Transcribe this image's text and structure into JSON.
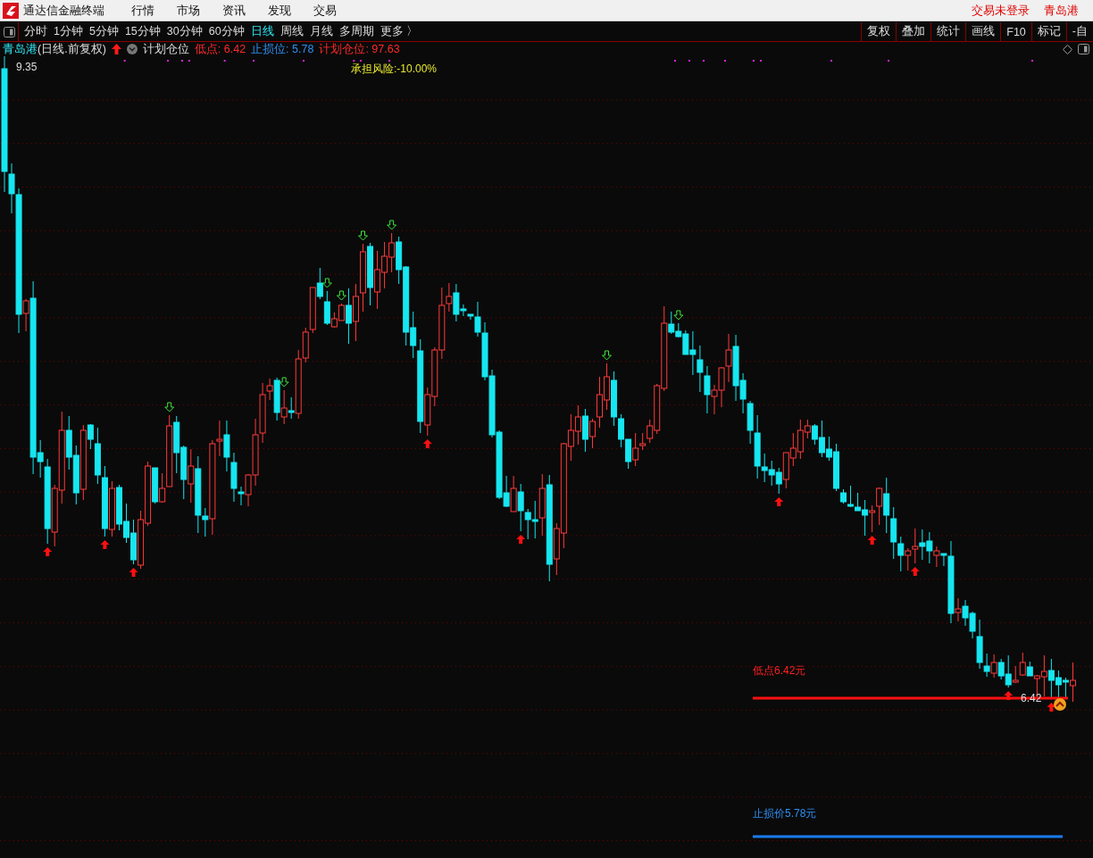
{
  "title_bar": {
    "app_title": "通达信金融终端",
    "menu": [
      "行情",
      "市场",
      "资讯",
      "发现",
      "交易"
    ],
    "status": [
      "交易未登录",
      "青岛港"
    ]
  },
  "period_tabs": [
    {
      "label": "分时",
      "selected": false
    },
    {
      "label": "1分钟",
      "selected": false
    },
    {
      "label": "5分钟",
      "selected": false
    },
    {
      "label": "15分钟",
      "selected": false
    },
    {
      "label": "30分钟",
      "selected": false
    },
    {
      "label": "60分钟",
      "selected": false
    },
    {
      "label": "日线",
      "selected": true
    },
    {
      "label": "周线",
      "selected": false
    },
    {
      "label": "月线",
      "selected": false
    },
    {
      "label": "多周期",
      "selected": false
    },
    {
      "label": "更多 〉",
      "selected": false
    }
  ],
  "tools": [
    "复权",
    "叠加",
    "统计",
    "画线",
    "F10",
    "标记",
    "-自"
  ],
  "info": {
    "stock_name": "青岛港",
    "mode": "(日线.前复权)",
    "indicator": "计划仓位",
    "low": "低点: 6.42",
    "stop": "止损位: 5.78",
    "position": "计划仓位: 97.63"
  },
  "chart": {
    "high_label": "9.35",
    "risk": "承担风险:-10.00%",
    "low_line_label": "低点6.42元",
    "low_marker": "6.42",
    "stop_line_label": "止损价5.78元"
  }
}
